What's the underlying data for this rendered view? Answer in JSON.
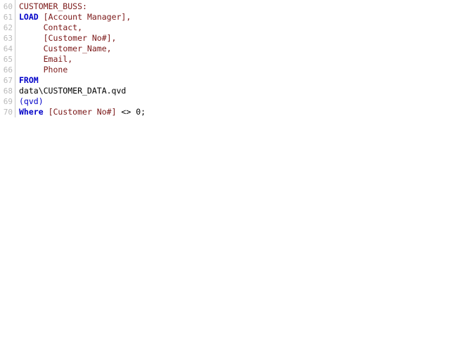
{
  "editor": {
    "name": "qlik-load-script-editor",
    "background_color": "#ffffff",
    "gutter_color": "#b9b9b9",
    "gutter_rule_color": "#c8c8c8",
    "colors": {
      "keyword": "#0000c8",
      "field": "#7a1717",
      "plain": "#000000"
    },
    "first_line_number": 60,
    "last_line_number": 70,
    "line_numbers": [
      "60",
      "61",
      "62",
      "63",
      "64",
      "65",
      "66",
      "67",
      "68",
      "69",
      "70"
    ],
    "lines": [
      {
        "number": "60",
        "text": "CUSTOMER_BUSS:",
        "tokens": [
          {
            "text": "CUSTOMER_BUSS:",
            "type": "field"
          }
        ]
      },
      {
        "number": "61",
        "text": "LOAD [Account Manager],",
        "tokens": [
          {
            "text": "LOAD",
            "type": "keyword"
          },
          {
            "text": " ",
            "type": "plain"
          },
          {
            "text": "[Account Manager],",
            "type": "field"
          }
        ]
      },
      {
        "number": "62",
        "text": "     Contact,",
        "tokens": [
          {
            "text": "     ",
            "type": "plain"
          },
          {
            "text": "Contact,",
            "type": "field"
          }
        ]
      },
      {
        "number": "63",
        "text": "     [Customer No#],",
        "tokens": [
          {
            "text": "     ",
            "type": "plain"
          },
          {
            "text": "[Customer No#],",
            "type": "field"
          }
        ]
      },
      {
        "number": "64",
        "text": "     Customer_Name,",
        "tokens": [
          {
            "text": "     ",
            "type": "plain"
          },
          {
            "text": "Customer_Name,",
            "type": "field"
          }
        ]
      },
      {
        "number": "65",
        "text": "     Email,",
        "tokens": [
          {
            "text": "     ",
            "type": "plain"
          },
          {
            "text": "Email,",
            "type": "field"
          }
        ]
      },
      {
        "number": "66",
        "text": "     Phone",
        "tokens": [
          {
            "text": "     ",
            "type": "plain"
          },
          {
            "text": "Phone",
            "type": "field"
          }
        ]
      },
      {
        "number": "67",
        "text": "FROM",
        "tokens": [
          {
            "text": "FROM",
            "type": "keyword"
          }
        ]
      },
      {
        "number": "68",
        "text": "data\\CUSTOMER_DATA.qvd",
        "tokens": [
          {
            "text": "data\\CUSTOMER_DATA.qvd",
            "type": "plain"
          }
        ]
      },
      {
        "number": "69",
        "text": "(qvd)",
        "tokens": [
          {
            "text": "(qvd)",
            "type": "bluetext"
          }
        ]
      },
      {
        "number": "70",
        "text": "Where [Customer No#] <> 0;",
        "tokens": [
          {
            "text": "Where",
            "type": "keyword"
          },
          {
            "text": " ",
            "type": "plain"
          },
          {
            "text": "[Customer No#]",
            "type": "field"
          },
          {
            "text": " <> 0;",
            "type": "plain"
          }
        ]
      }
    ]
  }
}
